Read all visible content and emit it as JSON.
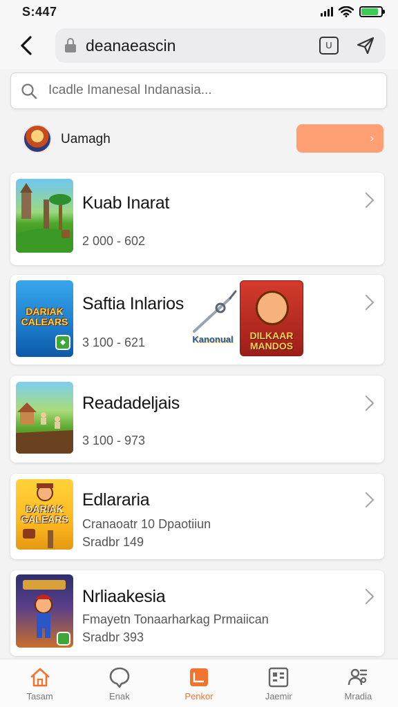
{
  "status_bar": {
    "time": "S:447",
    "battery_level": 0.85
  },
  "browser": {
    "url": "deanaeascin",
    "tabs_label": "U"
  },
  "search": {
    "placeholder": "Icadle Imanesal Indanasia..."
  },
  "user": {
    "name": "Uamagh",
    "action_label": "›"
  },
  "cards": [
    {
      "title": "Kuab Inarat",
      "subtitle": "2 000 - 602",
      "subtitle2": "",
      "thumb_label": ""
    },
    {
      "title": "Saftia Inlarios",
      "subtitle": "3 100 - 621",
      "subtitle2": "",
      "thumb_label": "DARIAK CALEARS",
      "promo_logo_text": "Kanonual",
      "promo_art_text": "DILKAAR MANDOS"
    },
    {
      "title": "Readadeljais",
      "subtitle": "3 100 - 973",
      "subtitle2": "",
      "thumb_label": ""
    },
    {
      "title": "Edlararia",
      "subtitle": "Cranaoatr 10 Dpaotiiun",
      "subtitle2": "Sradbr 149",
      "thumb_label": "DARIAK GALEARS"
    },
    {
      "title": "Nrliaakesia",
      "subtitle": "Fmayetn Tonaarharkag Prmaiican",
      "subtitle2": "Sradbr 393",
      "thumb_label": ""
    }
  ],
  "nav": [
    {
      "label": "Tasam",
      "icon": "home-icon"
    },
    {
      "label": "Enak",
      "icon": "chat-icon"
    },
    {
      "label": "Penkor",
      "icon": "grid-icon"
    },
    {
      "label": "Jaemir",
      "icon": "apps-icon"
    },
    {
      "label": "Mradia",
      "icon": "people-icon"
    }
  ],
  "colors": {
    "accent": "#f0742e",
    "action_button": "#ff9f73"
  }
}
